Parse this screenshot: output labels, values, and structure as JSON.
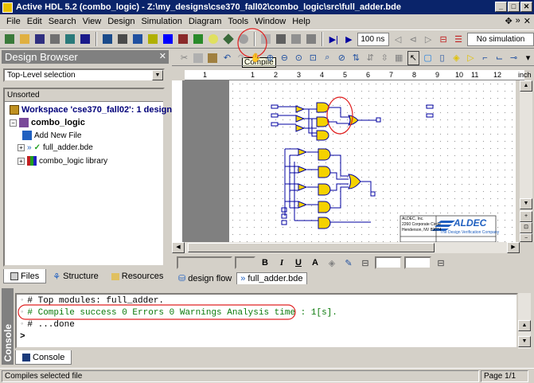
{
  "window": {
    "title": "Active HDL 5.2 (combo_logic) - Z:\\my_designs\\cse370_fall02\\combo_logic\\src\\full_adder.bde"
  },
  "menu": [
    "File",
    "Edit",
    "Search",
    "View",
    "Design",
    "Simulation",
    "Diagram",
    "Tools",
    "Window",
    "Help"
  ],
  "toolbar": {
    "sim_time": "100 ns",
    "sim_status": "No simulation",
    "tooltip": "Compile"
  },
  "browser": {
    "title": "Design Browser",
    "selector": "Top-Level selection",
    "header": "Unsorted",
    "workspace": "Workspace 'cse370_fall02': 1 design(s)",
    "design": "combo_logic",
    "items": [
      "Add New File",
      "full_adder.bde",
      "combo_logic library"
    ],
    "tabs": [
      "Files",
      "Structure",
      "Resources"
    ]
  },
  "ruler": {
    "unit": "inch",
    "ticks": [
      "1",
      "1",
      "2",
      "3",
      "4",
      "5",
      "6",
      "7",
      "8",
      "9",
      "10",
      "11",
      "12"
    ]
  },
  "titleblock": {
    "logo": "ALDEC",
    "tagline": "The Design Verification Company",
    "address": [
      "ALDEC, Inc.",
      "2260 Corporate Circle",
      "Henderson, NV 89074"
    ],
    "sheet": "Page 1/1"
  },
  "editor": {
    "tabs": [
      "design flow",
      "full_adder.bde"
    ]
  },
  "console": {
    "label": "Console",
    "lines": [
      "# Top modules: full_adder.",
      "# Compile success 0 Errors 0 Warnings  Analysis time : 1[s].",
      "# ...done",
      ">"
    ],
    "tab": "Console"
  },
  "status": {
    "message": "Compiles selected file",
    "page": "Page 1/1"
  },
  "colors": {
    "title_bg": "#0a246a",
    "success_text": "#0a7a0a",
    "highlight_circle": "#e02020",
    "gate_fill": "#f5d200",
    "wire": "#0000a0"
  }
}
